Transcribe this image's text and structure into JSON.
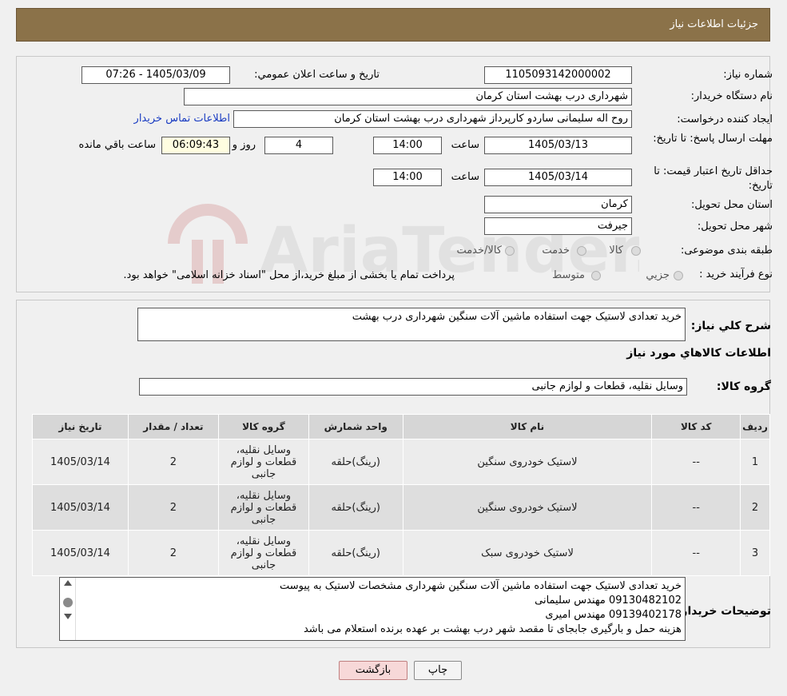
{
  "header": {
    "title": "جزئیات اطلاعات نیاز"
  },
  "form": {
    "need_number_label": "شماره نیاز:",
    "need_number": "1105093142000002",
    "announce_label": "تاریخ و ساعت اعلان عمومي:",
    "announce_value": "1405/03/09 - 07:26",
    "buyer_org_label": "نام دستگاه خریدار:",
    "buyer_org": "شهرداری درب بهشت استان کرمان",
    "requester_label": "ایجاد کننده درخواست:",
    "requester": "روح اله سلیمانی ساردو کارپرداز شهرداری درب بهشت استان کرمان",
    "contact_link": "اطلاعات تماس خریدار",
    "reply_deadline_label": "مهلت ارسال پاسخ: تا تاریخ:",
    "reply_date": "1405/03/13",
    "time_label": "ساعت",
    "reply_time": "14:00",
    "days_value": "4",
    "days_label": "روز و",
    "remaining_time": "06:09:43",
    "remaining_label": "ساعت باقي مانده",
    "validity_label": "حداقل تاریخ اعتبار قیمت: تا تاریخ:",
    "validity_date": "1405/03/14",
    "validity_time": "14:00",
    "province_label": "استان محل تحویل:",
    "province": "کرمان",
    "city_label": "شهر محل تحویل:",
    "city": "جیرفت",
    "category_label": "طبقه بندی موضوعی:",
    "category_options": [
      "کالا",
      "خدمت",
      "کالا/خدمت"
    ],
    "process_label": "نوع فرآیند خرید :",
    "process_options": [
      "جزیي",
      "متوسط"
    ],
    "process_note": "پرداخت تمام یا بخشی از مبلغ خرید،از محل \"اسناد خزانه اسلامی\" خواهد بود."
  },
  "summary": {
    "description_label": "شرح کلي نیاز:",
    "description": "خرید تعدادی لاستیک جهت استفاده ماشین آلات سنگین شهرداری درب بهشت",
    "items_heading": "اطلاعات کالاهاي مورد نیاز",
    "group_label": "گروه کالا:",
    "group_value": "وسایل نقلیه، قطعات و لوازم جانبی",
    "table": {
      "headers": [
        "ردیف",
        "کد کالا",
        "نام کالا",
        "واحد شمارش",
        "گروه کالا",
        "تعداد / مقدار",
        "تاریخ نیاز"
      ],
      "rows": [
        [
          "1",
          "--",
          "لاستیک خودروی سنگین",
          "(رینگ)حلقه",
          "وسایل نقلیه، قطعات و لوازم جانبی",
          "2",
          "1405/03/14"
        ],
        [
          "2",
          "--",
          "لاستیک خودروی سنگین",
          "(رینگ)حلقه",
          "وسایل نقلیه، قطعات و لوازم جانبی",
          "2",
          "1405/03/14"
        ],
        [
          "3",
          "--",
          "لاستیک خودروی سبک",
          "(رینگ)حلقه",
          "وسایل نقلیه، قطعات و لوازم جانبی",
          "2",
          "1405/03/14"
        ]
      ]
    },
    "buyer_notes_label": "توضیحات خریدار:",
    "buyer_notes": [
      "خرید تعدادی لاستیک جهت استفاده ماشین آلات سنگین شهرداری مشخصات لاستیک به پیوست",
      "09130482102 مهندس سلیمانی",
      "09139402178 مهندس امیری",
      "هزینه حمل و بارگیری جابجای تا مقصد شهر درب بهشت بر عهده برنده استعلام می باشد"
    ]
  },
  "buttons": {
    "print": "چاپ",
    "back": "بازگشت"
  },
  "watermark": {
    "text": "AriaTender.neT"
  }
}
